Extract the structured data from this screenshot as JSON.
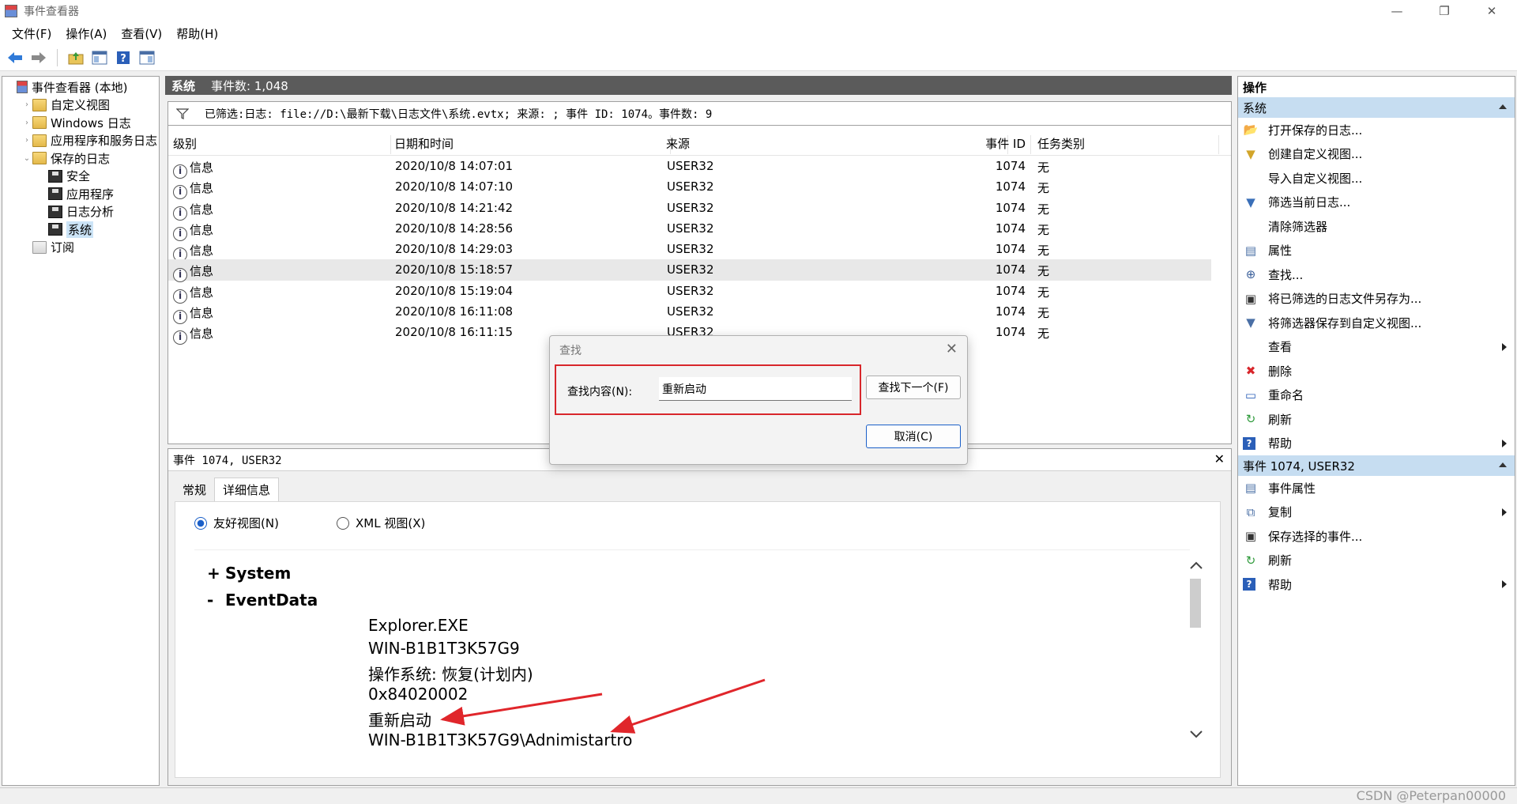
{
  "window": {
    "title": "事件查看器",
    "minimize": "—",
    "restore": "❐",
    "close": "✕"
  },
  "menu": [
    "文件(F)",
    "操作(A)",
    "查看(V)",
    "帮助(H)"
  ],
  "tree": {
    "items": [
      {
        "label": "事件查看器 (本地)",
        "icon": "event-viewer-icon",
        "indent": 0,
        "arrow": ""
      },
      {
        "label": "自定义视图",
        "icon": "folder-icon",
        "indent": 1,
        "arrow": "›"
      },
      {
        "label": "Windows 日志",
        "icon": "folder-icon",
        "indent": 1,
        "arrow": "›"
      },
      {
        "label": "应用程序和服务日志",
        "icon": "folder-icon",
        "indent": 1,
        "arrow": "›"
      },
      {
        "label": "保存的日志",
        "icon": "folder-icon",
        "indent": 1,
        "arrow": "⌄"
      },
      {
        "label": "安全",
        "icon": "disk-icon",
        "indent": 2,
        "arrow": ""
      },
      {
        "label": "应用程序",
        "icon": "disk-icon",
        "indent": 2,
        "arrow": ""
      },
      {
        "label": "日志分析",
        "icon": "disk-icon",
        "indent": 2,
        "arrow": ""
      },
      {
        "label": "系统",
        "icon": "disk-icon",
        "indent": 2,
        "arrow": "",
        "selected": true
      },
      {
        "label": "订阅",
        "icon": "subscription-icon",
        "indent": 1,
        "arrow": ""
      }
    ]
  },
  "center": {
    "header_title": "系统",
    "header_count": "事件数: 1,048",
    "filter_text": "已筛选:日志: file://D:\\最新下载\\日志文件\\系统.evtx; 来源: ; 事件 ID: 1074。事件数: 9",
    "columns": [
      "级别",
      "日期和时间",
      "来源",
      "事件 ID",
      "任务类别"
    ],
    "rows": [
      {
        "level": "信息",
        "datetime": "2020/10/8 14:07:01",
        "source": "USER32",
        "event_id": "1074",
        "task": "无"
      },
      {
        "level": "信息",
        "datetime": "2020/10/8 14:07:10",
        "source": "USER32",
        "event_id": "1074",
        "task": "无"
      },
      {
        "level": "信息",
        "datetime": "2020/10/8 14:21:42",
        "source": "USER32",
        "event_id": "1074",
        "task": "无"
      },
      {
        "level": "信息",
        "datetime": "2020/10/8 14:28:56",
        "source": "USER32",
        "event_id": "1074",
        "task": "无"
      },
      {
        "level": "信息",
        "datetime": "2020/10/8 14:29:03",
        "source": "USER32",
        "event_id": "1074",
        "task": "无"
      },
      {
        "level": "信息",
        "datetime": "2020/10/8 15:18:57",
        "source": "USER32",
        "event_id": "1074",
        "task": "无",
        "selected": true
      },
      {
        "level": "信息",
        "datetime": "2020/10/8 15:19:04",
        "source": "USER32",
        "event_id": "1074",
        "task": "无"
      },
      {
        "level": "信息",
        "datetime": "2020/10/8 16:11:08",
        "source": "USER32",
        "event_id": "1074",
        "task": "无"
      },
      {
        "level": "信息",
        "datetime": "2020/10/8 16:11:15",
        "source": "USER32",
        "event_id": "1074",
        "task": "无"
      }
    ]
  },
  "detail": {
    "header": "事件 1074, USER32",
    "close": "✕",
    "tabs": [
      "常规",
      "详细信息"
    ],
    "radio_friendly": "友好视图(N)",
    "radio_xml": "XML 视图(X)",
    "system_label": "System",
    "system_toggle": "+",
    "eventdata_label": "EventData",
    "eventdata_toggle": "-",
    "eventdata_lines": [
      "Explorer.EXE",
      "WIN-B1B1T3K57G9",
      "操作系统: 恢复(计划内)",
      "0x84020002",
      "重新启动",
      "WIN-B1B1T3K57G9\\Adnimistartro"
    ]
  },
  "actions": {
    "title": "操作",
    "section1": "系统",
    "section1_items": [
      {
        "label": "打开保存的日志...",
        "icon": "open-folder-icon",
        "sub": false
      },
      {
        "label": "创建自定义视图...",
        "icon": "filter-create-icon",
        "sub": false
      },
      {
        "label": "导入自定义视图...",
        "icon": "",
        "sub": false
      },
      {
        "label": "筛选当前日志...",
        "icon": "filter-icon",
        "sub": false
      },
      {
        "label": "清除筛选器",
        "icon": "",
        "sub": false
      },
      {
        "label": "属性",
        "icon": "properties-icon",
        "sub": false
      },
      {
        "label": "查找...",
        "icon": "find-icon",
        "sub": false
      },
      {
        "label": "将已筛选的日志文件另存为...",
        "icon": "save-icon",
        "sub": false
      },
      {
        "label": "将筛选器保存到自定义视图...",
        "icon": "save-filter-icon",
        "sub": false
      },
      {
        "label": "查看",
        "icon": "",
        "sub": true
      },
      {
        "label": "删除",
        "icon": "delete-icon",
        "sub": false
      },
      {
        "label": "重命名",
        "icon": "rename-icon",
        "sub": false
      },
      {
        "label": "刷新",
        "icon": "refresh-icon",
        "sub": false
      },
      {
        "label": "帮助",
        "icon": "help-icon",
        "sub": true
      }
    ],
    "section2": "事件 1074, USER32",
    "section2_items": [
      {
        "label": "事件属性",
        "icon": "event-properties-icon",
        "sub": false
      },
      {
        "label": "复制",
        "icon": "copy-icon",
        "sub": true
      },
      {
        "label": "保存选择的事件...",
        "icon": "save-icon",
        "sub": false
      },
      {
        "label": "刷新",
        "icon": "refresh-icon",
        "sub": false
      },
      {
        "label": "帮助",
        "icon": "help-icon",
        "sub": true
      }
    ]
  },
  "find_dialog": {
    "title": "查找",
    "close": "✕",
    "label": "查找内容(N):",
    "value": "重新启动",
    "find_next": "查找下一个(F)",
    "cancel": "取消(C)"
  },
  "watermark": "CSDN @Peterpan00000",
  "colors": {
    "accent": "#1a5fc8",
    "highlight_box": "#d8262b",
    "annotation_arrow": "#e0262b",
    "section_bg": "#c6ddf1",
    "header_bg": "#5b5b5b"
  }
}
